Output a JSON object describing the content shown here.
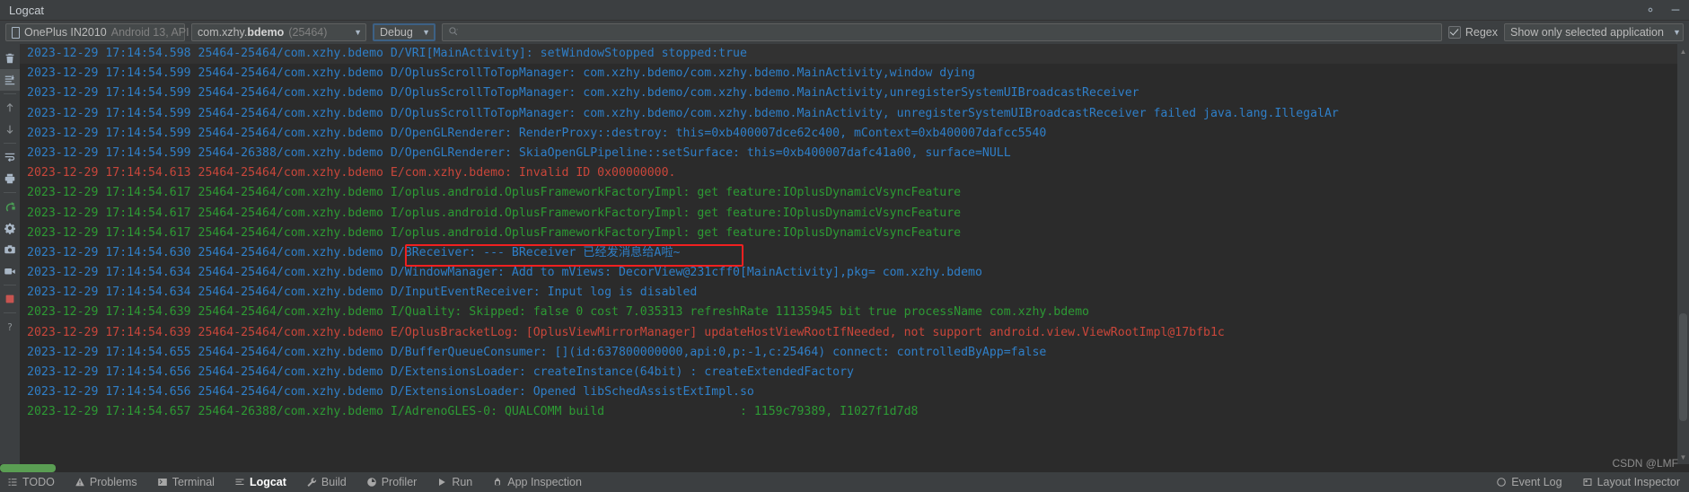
{
  "window": {
    "title": "Logcat",
    "settings_icon": "gear-icon",
    "minimize_icon": "minimize-icon"
  },
  "toolbar": {
    "device": {
      "name": "OnePlus IN2010",
      "detail": "Android 13, API",
      "icon": "phone-icon"
    },
    "process": {
      "package_prefix": "com.xzhy.",
      "package_suffix": "bdemo",
      "pid": "(25464)"
    },
    "log_level": "Debug",
    "search": {
      "placeholder": "",
      "value": "",
      "icon": "search-icon"
    },
    "regex": {
      "label": "Regex",
      "checked": true
    },
    "scope": "Show only selected application"
  },
  "gutter_icons": [
    {
      "name": "clear-logcat-icon",
      "glyph": "trash"
    },
    {
      "name": "scroll-to-end-icon",
      "glyph": "scroll-end",
      "selected": true
    },
    {
      "name": "previous-occurrence-icon",
      "glyph": "arrow-up"
    },
    {
      "name": "next-occurrence-icon",
      "glyph": "arrow-down"
    },
    {
      "name": "soft-wrap-icon",
      "glyph": "wrap"
    },
    {
      "name": "print-icon",
      "glyph": "print"
    },
    {
      "name": "restart-icon",
      "glyph": "restart"
    },
    {
      "name": "settings-icon",
      "glyph": "gear"
    },
    {
      "name": "screenshot-icon",
      "glyph": "camera"
    },
    {
      "name": "screen-record-icon",
      "glyph": "video"
    },
    {
      "name": "stop-icon",
      "glyph": "stop"
    },
    {
      "name": "help-icon",
      "glyph": "help"
    }
  ],
  "log": {
    "lines": [
      {
        "level": "D",
        "selected": true,
        "text": "2023-12-29 17:14:54.598 25464-25464/com.xzhy.bdemo D/VRI[MainActivity]: setWindowStopped stopped:true"
      },
      {
        "level": "D",
        "selected": false,
        "text": "2023-12-29 17:14:54.599 25464-25464/com.xzhy.bdemo D/OplusScrollToTopManager: com.xzhy.bdemo/com.xzhy.bdemo.MainActivity,window dying"
      },
      {
        "level": "D",
        "selected": false,
        "text": "2023-12-29 17:14:54.599 25464-25464/com.xzhy.bdemo D/OplusScrollToTopManager: com.xzhy.bdemo/com.xzhy.bdemo.MainActivity,unregisterSystemUIBroadcastReceiver"
      },
      {
        "level": "D",
        "selected": false,
        "text": "2023-12-29 17:14:54.599 25464-25464/com.xzhy.bdemo D/OplusScrollToTopManager: com.xzhy.bdemo/com.xzhy.bdemo.MainActivity, unregisterSystemUIBroadcastReceiver failed java.lang.IllegalAr"
      },
      {
        "level": "D",
        "selected": false,
        "text": "2023-12-29 17:14:54.599 25464-25464/com.xzhy.bdemo D/OpenGLRenderer: RenderProxy::destroy: this=0xb400007dce62c400, mContext=0xb400007dafcc5540"
      },
      {
        "level": "D",
        "selected": false,
        "text": "2023-12-29 17:14:54.599 25464-26388/com.xzhy.bdemo D/OpenGLRenderer: SkiaOpenGLPipeline::setSurface: this=0xb400007dafc41a00, surface=NULL"
      },
      {
        "level": "E",
        "selected": false,
        "text": "2023-12-29 17:14:54.613 25464-25464/com.xzhy.bdemo E/com.xzhy.bdemo: Invalid ID 0x00000000."
      },
      {
        "level": "I",
        "selected": false,
        "text": "2023-12-29 17:14:54.617 25464-25464/com.xzhy.bdemo I/oplus.android.OplusFrameworkFactoryImpl: get feature:IOplusDynamicVsyncFeature"
      },
      {
        "level": "I",
        "selected": false,
        "text": "2023-12-29 17:14:54.617 25464-25464/com.xzhy.bdemo I/oplus.android.OplusFrameworkFactoryImpl: get feature:IOplusDynamicVsyncFeature"
      },
      {
        "level": "I",
        "selected": false,
        "text": "2023-12-29 17:14:54.617 25464-25464/com.xzhy.bdemo I/oplus.android.OplusFrameworkFactoryImpl: get feature:IOplusDynamicVsyncFeature"
      },
      {
        "level": "D",
        "selected": false,
        "highlighted": true,
        "text": "2023-12-29 17:14:54.630 25464-25464/com.xzhy.bdemo D/BReceiver: --- BReceiver 已经发消息给A啦~"
      },
      {
        "level": "D",
        "selected": false,
        "text": "2023-12-29 17:14:54.634 25464-25464/com.xzhy.bdemo D/WindowManager: Add to mViews: DecorView@231cff0[MainActivity],pkg= com.xzhy.bdemo"
      },
      {
        "level": "D",
        "selected": false,
        "text": "2023-12-29 17:14:54.634 25464-25464/com.xzhy.bdemo D/InputEventReceiver: Input log is disabled"
      },
      {
        "level": "I",
        "selected": false,
        "text": "2023-12-29 17:14:54.639 25464-25464/com.xzhy.bdemo I/Quality: Skipped: false 0 cost 7.035313 refreshRate 11135945 bit true processName com.xzhy.bdemo"
      },
      {
        "level": "E",
        "selected": false,
        "text": "2023-12-29 17:14:54.639 25464-25464/com.xzhy.bdemo E/OplusBracketLog: [OplusViewMirrorManager] updateHostViewRootIfNeeded, not support android.view.ViewRootImpl@17bfb1c"
      },
      {
        "level": "D",
        "selected": false,
        "text": "2023-12-29 17:14:54.655 25464-25464/com.xzhy.bdemo D/BufferQueueConsumer: [](id:637800000000,api:0,p:-1,c:25464) connect: controlledByApp=false"
      },
      {
        "level": "D",
        "selected": false,
        "text": "2023-12-29 17:14:54.656 25464-25464/com.xzhy.bdemo D/ExtensionsLoader: createInstance(64bit) : createExtendedFactory"
      },
      {
        "level": "D",
        "selected": false,
        "text": "2023-12-29 17:14:54.656 25464-25464/com.xzhy.bdemo D/ExtensionsLoader: Opened libSchedAssistExtImpl.so"
      },
      {
        "level": "I",
        "selected": false,
        "text": "2023-12-29 17:14:54.657 25464-26388/com.xzhy.bdemo I/AdrenoGLES-0: QUALCOMM build                   : 1159c79389, I1027f1d7d8"
      }
    ]
  },
  "statusbar": {
    "left_items": [
      {
        "label": "TODO",
        "icon": "todo-icon",
        "active": false
      },
      {
        "label": "Problems",
        "icon": "problems-icon",
        "active": false
      },
      {
        "label": "Terminal",
        "icon": "terminal-icon",
        "active": false
      },
      {
        "label": "Logcat",
        "icon": "logcat-icon",
        "active": true
      },
      {
        "label": "Build",
        "icon": "build-icon",
        "active": false
      },
      {
        "label": "Profiler",
        "icon": "profiler-icon",
        "active": false
      },
      {
        "label": "Run",
        "icon": "run-icon",
        "active": false
      },
      {
        "label": "App Inspection",
        "icon": "app-inspection-icon",
        "active": false
      }
    ],
    "right_items": [
      {
        "label": "Event Log",
        "icon": "event-log-icon"
      },
      {
        "label": "Layout Inspector",
        "icon": "layout-inspector-icon"
      }
    ]
  },
  "watermark": "CSDN @LMF"
}
